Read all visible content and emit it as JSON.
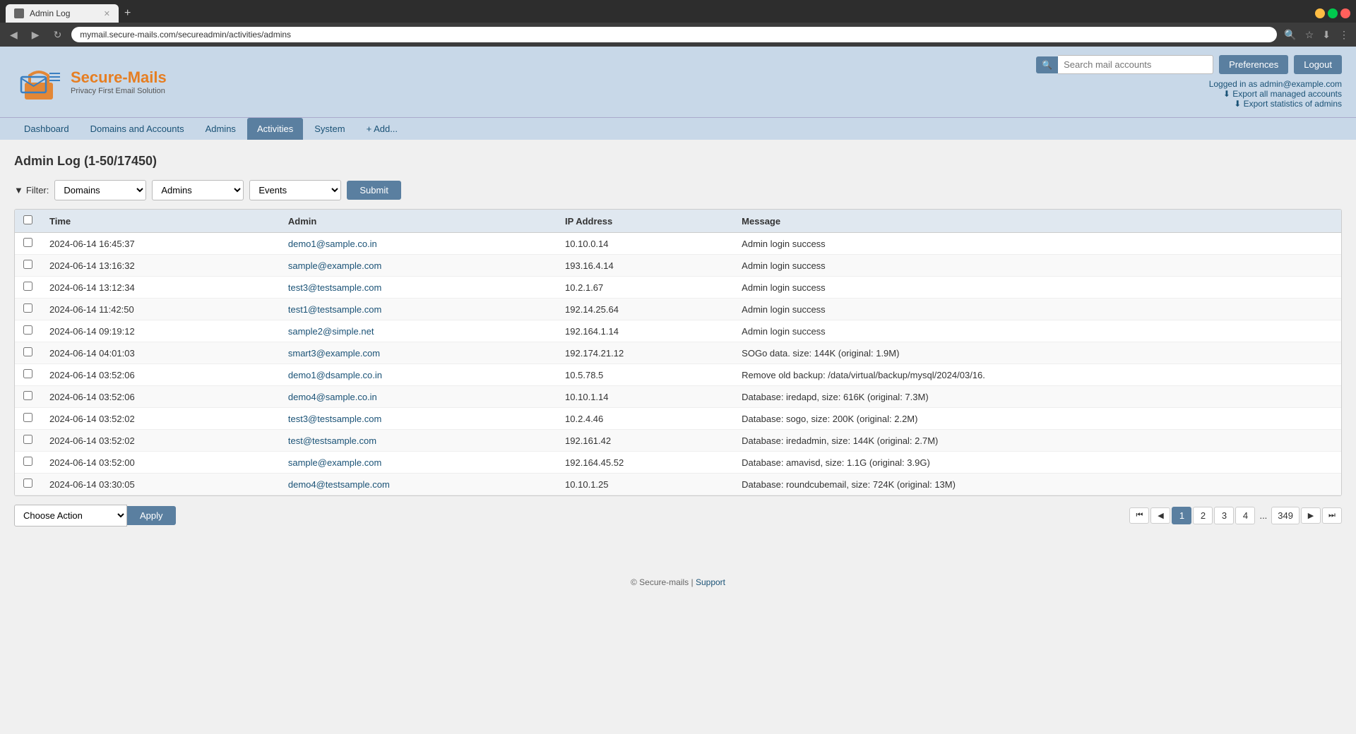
{
  "browser": {
    "tab_title": "Admin Log",
    "address": "mymail.secure-mails.com/secureadmin/activities/admins",
    "new_tab_label": "+",
    "nav_back": "◀",
    "nav_forward": "▶",
    "nav_refresh": "↻"
  },
  "header": {
    "logo_text": "Secure-Mails",
    "logo_tagline": "Privacy First Email Solution",
    "search_placeholder": "Search mail accounts",
    "preferences_label": "Preferences",
    "logout_label": "Logout",
    "logged_in_text": "Logged in as admin@example.com",
    "export_accounts": "Export all managed accounts",
    "export_stats": "Export statistics of admins"
  },
  "nav": {
    "items": [
      {
        "label": "Dashboard",
        "active": false
      },
      {
        "label": "Domains and Accounts",
        "active": false
      },
      {
        "label": "Admins",
        "active": false
      },
      {
        "label": "Activities",
        "active": true
      },
      {
        "label": "System",
        "active": false
      }
    ],
    "add_label": "+ Add..."
  },
  "content": {
    "page_title": "Admin Log (1-50/17450)",
    "filter": {
      "label": "Filter:",
      "domains_placeholder": "Domains",
      "admins_placeholder": "Admins",
      "events_placeholder": "Events",
      "submit_label": "Submit"
    },
    "table": {
      "columns": [
        "",
        "Time",
        "Admin",
        "IP Address",
        "Message"
      ],
      "rows": [
        {
          "time": "2024-06-14 16:45:37",
          "admin": "demo1@sample.co.in",
          "ip": "10.10.0.14",
          "message": "Admin login success"
        },
        {
          "time": "2024-06-14 13:16:32",
          "admin": "sample@example.com",
          "ip": "193.16.4.14",
          "message": "Admin login success"
        },
        {
          "time": "2024-06-14 13:12:34",
          "admin": "test3@testsample.com",
          "ip": "10.2.1.67",
          "message": "Admin login success"
        },
        {
          "time": "2024-06-14 11:42:50",
          "admin": "test1@testsample.com",
          "ip": "192.14.25.64",
          "message": "Admin login success"
        },
        {
          "time": "2024-06-14 09:19:12",
          "admin": "sample2@simple.net",
          "ip": "192.164.1.14",
          "message": "Admin login success"
        },
        {
          "time": "2024-06-14 04:01:03",
          "admin": "smart3@example.com",
          "ip": "192.174.21.12",
          "message": "SOGo data. size: 144K (original: 1.9M)"
        },
        {
          "time": "2024-06-14 03:52:06",
          "admin": "demo1@dsample.co.in",
          "ip": "10.5.78.5",
          "message": "Remove old backup: /data/virtual/backup/mysql/2024/03/16."
        },
        {
          "time": "2024-06-14 03:52:06",
          "admin": "demo4@sample.co.in",
          "ip": "10.10.1.14",
          "message": "Database: iredapd, size: 616K (original: 7.3M)"
        },
        {
          "time": "2024-06-14 03:52:02",
          "admin": "test3@testsample.com",
          "ip": "10.2.4.46",
          "message": "Database: sogo, size: 200K (original: 2.2M)"
        },
        {
          "time": "2024-06-14 03:52:02",
          "admin": "test@testsample.com",
          "ip": "192.161.42",
          "message": "Database: iredadmin, size: 144K (original: 2.7M)"
        },
        {
          "time": "2024-06-14 03:52:00",
          "admin": "sample@example.com",
          "ip": "192.164.45.52",
          "message": "Database: amavisd, size: 1.1G (original: 3.9G)"
        },
        {
          "time": "2024-06-14 03:30:05",
          "admin": "demo4@testsample.com",
          "ip": "10.10.1.25",
          "message": "Database: roundcubemail, size: 724K (original: 13M)"
        }
      ]
    },
    "choose_action_label": "Choose Action",
    "apply_label": "Apply",
    "pagination": {
      "current": 1,
      "pages": [
        "1",
        "2",
        "3",
        "4",
        "...",
        "349"
      ],
      "prev_label": "◀",
      "next_label": "▶",
      "first_label": "⏮",
      "last_label": "⏭"
    }
  },
  "footer": {
    "copyright": "© Secure-mails",
    "separator": "|",
    "support_label": "Support"
  }
}
